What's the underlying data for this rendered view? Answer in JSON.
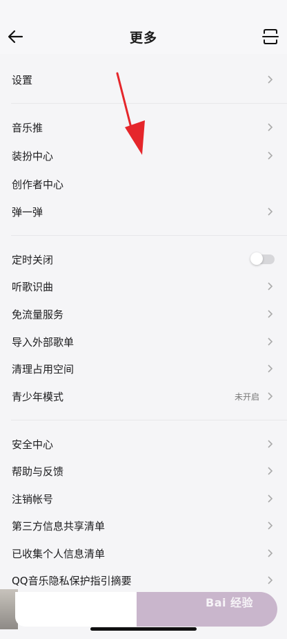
{
  "header": {
    "title": "更多"
  },
  "groups": [
    {
      "items": [
        {
          "label": "设置"
        }
      ]
    },
    {
      "items": [
        {
          "label": "音乐推"
        },
        {
          "label": "装扮中心"
        },
        {
          "label": "创作者中心"
        },
        {
          "label": "弹一弹"
        }
      ]
    },
    {
      "items": [
        {
          "label": "定时关闭",
          "toggle": false
        },
        {
          "label": "听歌识曲"
        },
        {
          "label": "免流量服务"
        },
        {
          "label": "导入外部歌单"
        },
        {
          "label": "清理占用空间"
        },
        {
          "label": "青少年模式",
          "value": "未开启"
        }
      ]
    },
    {
      "items": [
        {
          "label": "安全中心"
        },
        {
          "label": "帮助与反馈"
        },
        {
          "label": "注销帐号"
        },
        {
          "label": "第三方信息共享清单"
        },
        {
          "label": "已收集个人信息清单"
        },
        {
          "label": "QQ音乐隐私保护指引摘要"
        }
      ]
    }
  ],
  "watermark": "Bai 经验",
  "colors": {
    "accent_arrow": "#e5262b",
    "player_bar": "#c9b6cc"
  }
}
